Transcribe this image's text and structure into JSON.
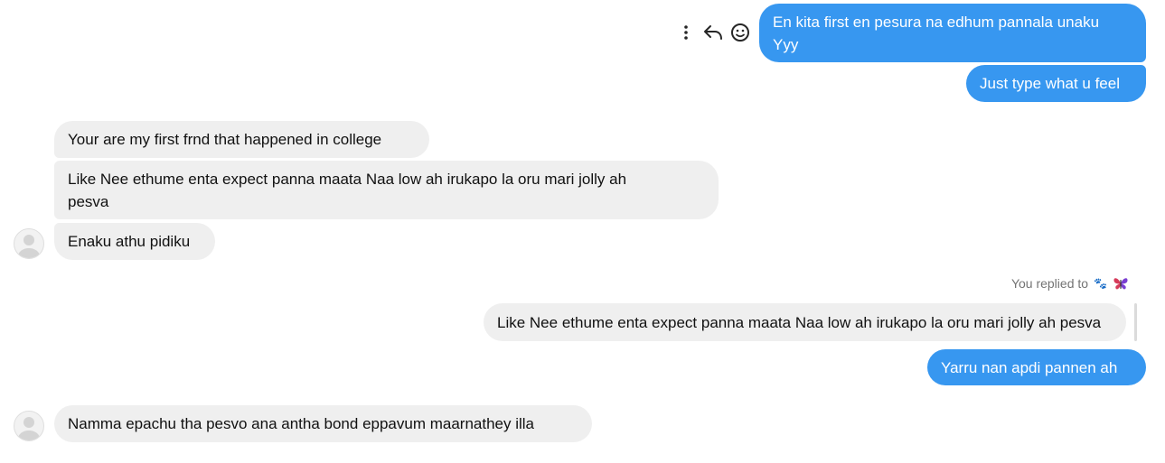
{
  "messages": {
    "m1_line1": "En kita first en pesura na edhum pannala unaku",
    "m1_line2": "Yyy",
    "m2": "Just type what u feel",
    "m3": "Your are my first frnd that happened in college",
    "m4_line1": "Like Nee ethume enta expect panna maata Naa low ah irukapo la oru mari jolly ah",
    "m4_line2": "pesva",
    "m5": "Enaku athu pidiku",
    "reply_label": "You replied to",
    "reply_quote": "Like Nee ethume enta expect panna maata Naa low ah irukapo la oru mari jolly ah pesva",
    "m6": "Yarru nan apdi pannen ah",
    "m7": "Namma epachu tha pesvo ana antha bond eppavum maarnathey illa"
  },
  "colors": {
    "outgoing_bubble": "#3797f0",
    "incoming_bubble": "#efefef",
    "meta_text": "#737373"
  },
  "icons": {
    "more": "more-options-icon",
    "reply": "reply-icon",
    "react": "emoji-react-icon",
    "avatar": "default-avatar-icon",
    "paw": "paw-emoji",
    "butterfly": "butterfly-emoji"
  }
}
